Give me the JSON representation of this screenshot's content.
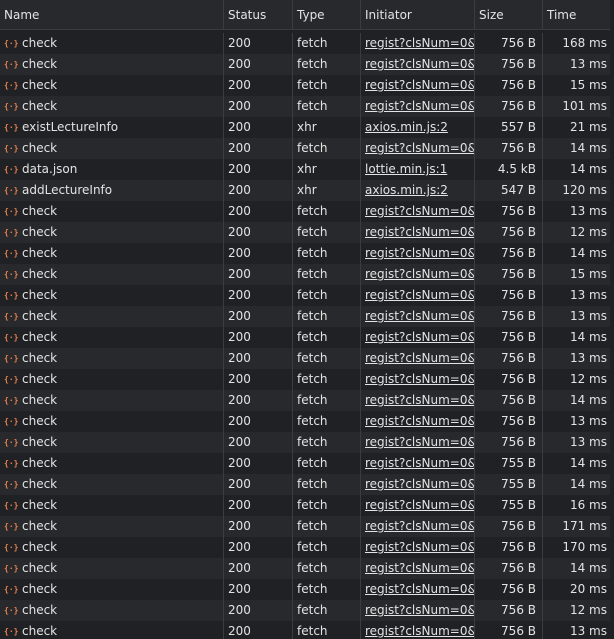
{
  "columns": [
    "Name",
    "Status",
    "Type",
    "Initiator",
    "Size",
    "Time"
  ],
  "rows": [
    {
      "name": "check",
      "status": "200",
      "type": "fetch",
      "initiator": "regist?clsNum=0&su",
      "size": "756 B",
      "time": "168 ms"
    },
    {
      "name": "check",
      "status": "200",
      "type": "fetch",
      "initiator": "regist?clsNum=0&su",
      "size": "756 B",
      "time": "13 ms"
    },
    {
      "name": "check",
      "status": "200",
      "type": "fetch",
      "initiator": "regist?clsNum=0&su",
      "size": "756 B",
      "time": "15 ms"
    },
    {
      "name": "check",
      "status": "200",
      "type": "fetch",
      "initiator": "regist?clsNum=0&su",
      "size": "756 B",
      "time": "101 ms"
    },
    {
      "name": "existLectureInfo",
      "status": "200",
      "type": "xhr",
      "initiator": "axios.min.js:2",
      "size": "557 B",
      "time": "21 ms"
    },
    {
      "name": "check",
      "status": "200",
      "type": "fetch",
      "initiator": "regist?clsNum=0&su",
      "size": "756 B",
      "time": "14 ms"
    },
    {
      "name": "data.json",
      "status": "200",
      "type": "xhr",
      "initiator": "lottie.min.js:1",
      "size": "4.5 kB",
      "time": "14 ms"
    },
    {
      "name": "addLectureInfo",
      "status": "200",
      "type": "xhr",
      "initiator": "axios.min.js:2",
      "size": "547 B",
      "time": "120 ms"
    },
    {
      "name": "check",
      "status": "200",
      "type": "fetch",
      "initiator": "regist?clsNum=0&su",
      "size": "756 B",
      "time": "13 ms"
    },
    {
      "name": "check",
      "status": "200",
      "type": "fetch",
      "initiator": "regist?clsNum=0&su",
      "size": "756 B",
      "time": "12 ms"
    },
    {
      "name": "check",
      "status": "200",
      "type": "fetch",
      "initiator": "regist?clsNum=0&su",
      "size": "756 B",
      "time": "14 ms"
    },
    {
      "name": "check",
      "status": "200",
      "type": "fetch",
      "initiator": "regist?clsNum=0&su",
      "size": "756 B",
      "time": "15 ms"
    },
    {
      "name": "check",
      "status": "200",
      "type": "fetch",
      "initiator": "regist?clsNum=0&su",
      "size": "756 B",
      "time": "13 ms"
    },
    {
      "name": "check",
      "status": "200",
      "type": "fetch",
      "initiator": "regist?clsNum=0&su",
      "size": "756 B",
      "time": "13 ms"
    },
    {
      "name": "check",
      "status": "200",
      "type": "fetch",
      "initiator": "regist?clsNum=0&su",
      "size": "756 B",
      "time": "14 ms"
    },
    {
      "name": "check",
      "status": "200",
      "type": "fetch",
      "initiator": "regist?clsNum=0&su",
      "size": "756 B",
      "time": "13 ms"
    },
    {
      "name": "check",
      "status": "200",
      "type": "fetch",
      "initiator": "regist?clsNum=0&su",
      "size": "756 B",
      "time": "12 ms"
    },
    {
      "name": "check",
      "status": "200",
      "type": "fetch",
      "initiator": "regist?clsNum=0&su",
      "size": "756 B",
      "time": "14 ms"
    },
    {
      "name": "check",
      "status": "200",
      "type": "fetch",
      "initiator": "regist?clsNum=0&su",
      "size": "756 B",
      "time": "13 ms"
    },
    {
      "name": "check",
      "status": "200",
      "type": "fetch",
      "initiator": "regist?clsNum=0&su",
      "size": "756 B",
      "time": "13 ms"
    },
    {
      "name": "check",
      "status": "200",
      "type": "fetch",
      "initiator": "regist?clsNum=0&su",
      "size": "755 B",
      "time": "14 ms"
    },
    {
      "name": "check",
      "status": "200",
      "type": "fetch",
      "initiator": "regist?clsNum=0&su",
      "size": "755 B",
      "time": "14 ms"
    },
    {
      "name": "check",
      "status": "200",
      "type": "fetch",
      "initiator": "regist?clsNum=0&su",
      "size": "755 B",
      "time": "16 ms"
    },
    {
      "name": "check",
      "status": "200",
      "type": "fetch",
      "initiator": "regist?clsNum=0&su",
      "size": "756 B",
      "time": "171 ms"
    },
    {
      "name": "check",
      "status": "200",
      "type": "fetch",
      "initiator": "regist?clsNum=0&su",
      "size": "756 B",
      "time": "170 ms"
    },
    {
      "name": "check",
      "status": "200",
      "type": "fetch",
      "initiator": "regist?clsNum=0&su",
      "size": "756 B",
      "time": "14 ms"
    },
    {
      "name": "check",
      "status": "200",
      "type": "fetch",
      "initiator": "regist?clsNum=0&su",
      "size": "756 B",
      "time": "20 ms"
    },
    {
      "name": "check",
      "status": "200",
      "type": "fetch",
      "initiator": "regist?clsNum=0&su",
      "size": "756 B",
      "time": "12 ms"
    },
    {
      "name": "check",
      "status": "200",
      "type": "fetch",
      "initiator": "regist?clsNum=0&su",
      "size": "756 B",
      "time": "13 ms"
    }
  ],
  "row_icon": "braces-icon",
  "icon_color": "#e8814d"
}
